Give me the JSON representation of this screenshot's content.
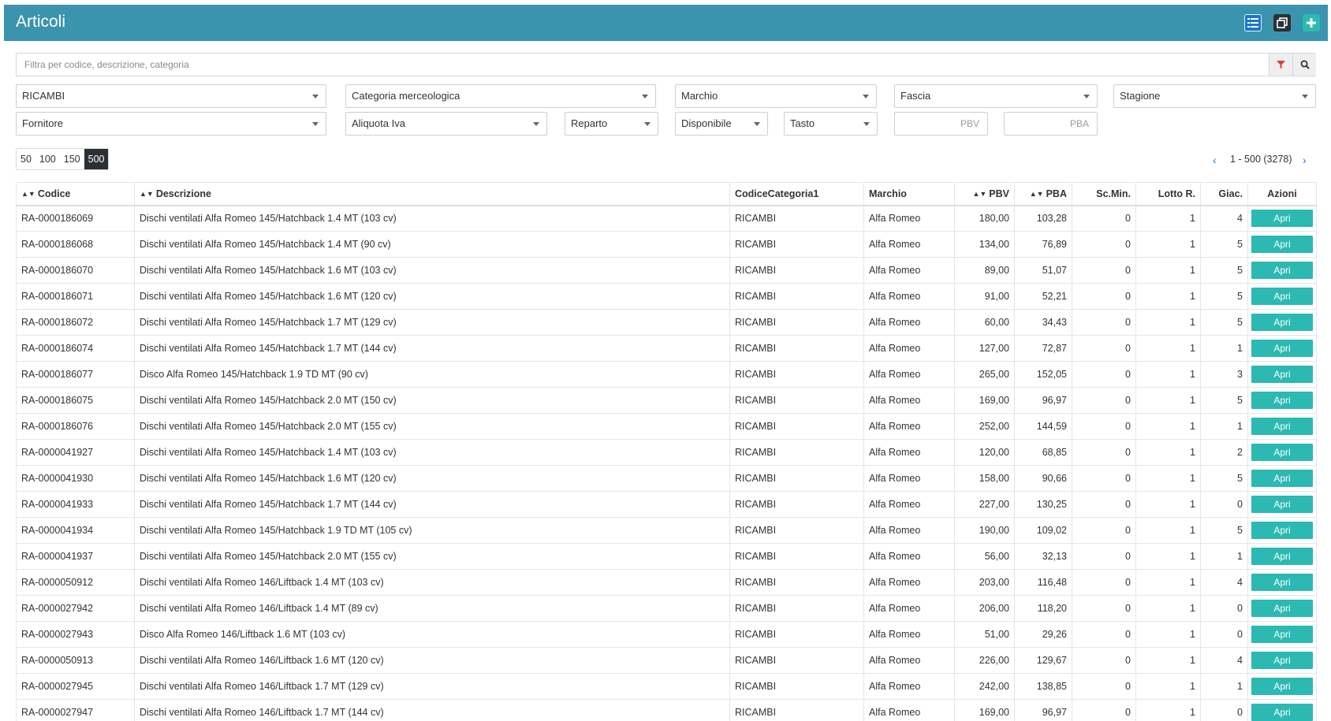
{
  "header": {
    "title": "Articoli"
  },
  "search": {
    "placeholder": "Filtra per codice, descrizione, categoria"
  },
  "filters": {
    "row1": [
      "RICAMBI",
      "Categoria merceologica",
      "Marchio",
      "Fascia",
      "Stagione"
    ],
    "row2": [
      "Fornitore",
      "Aliquota Iva",
      "Reparto",
      "Disponibile",
      "Tasto"
    ],
    "pbv_placeholder": "PBV",
    "pba_placeholder": "PBA"
  },
  "pager": {
    "sizes": [
      "50",
      "100",
      "150",
      "500"
    ],
    "active": "500",
    "range": "1 - 500 (3278)",
    "prev": "‹",
    "next": "›"
  },
  "table": {
    "headers": [
      "Codice",
      "Descrizione",
      "CodiceCategoria1",
      "Marchio",
      "PBV",
      "PBA",
      "Sc.Min.",
      "Lotto R.",
      "Giac.",
      "Azioni"
    ],
    "action_label": "Apri",
    "rows": [
      [
        "RA-0000186069",
        "Dischi ventilati Alfa Romeo 145/Hatchback 1.4 MT (103 cv)",
        "RICAMBI",
        "Alfa Romeo",
        "180,00",
        "103,28",
        "0",
        "1",
        "4"
      ],
      [
        "RA-0000186068",
        "Dischi ventilati Alfa Romeo 145/Hatchback 1.4 MT (90 cv)",
        "RICAMBI",
        "Alfa Romeo",
        "134,00",
        "76,89",
        "0",
        "1",
        "5"
      ],
      [
        "RA-0000186070",
        "Dischi ventilati Alfa Romeo 145/Hatchback 1.6 MT (103 cv)",
        "RICAMBI",
        "Alfa Romeo",
        "89,00",
        "51,07",
        "0",
        "1",
        "5"
      ],
      [
        "RA-0000186071",
        "Dischi ventilati Alfa Romeo 145/Hatchback 1.6 MT (120 cv)",
        "RICAMBI",
        "Alfa Romeo",
        "91,00",
        "52,21",
        "0",
        "1",
        "5"
      ],
      [
        "RA-0000186072",
        "Dischi ventilati Alfa Romeo 145/Hatchback 1.7 MT (129 cv)",
        "RICAMBI",
        "Alfa Romeo",
        "60,00",
        "34,43",
        "0",
        "1",
        "5"
      ],
      [
        "RA-0000186074",
        "Dischi ventilati Alfa Romeo 145/Hatchback 1.7 MT (144 cv)",
        "RICAMBI",
        "Alfa Romeo",
        "127,00",
        "72,87",
        "0",
        "1",
        "1"
      ],
      [
        "RA-0000186077",
        "Disco Alfa Romeo 145/Hatchback 1.9 TD MT (90 cv)",
        "RICAMBI",
        "Alfa Romeo",
        "265,00",
        "152,05",
        "0",
        "1",
        "3"
      ],
      [
        "RA-0000186075",
        "Dischi ventilati Alfa Romeo 145/Hatchback 2.0 MT (150 cv)",
        "RICAMBI",
        "Alfa Romeo",
        "169,00",
        "96,97",
        "0",
        "1",
        "5"
      ],
      [
        "RA-0000186076",
        "Dischi ventilati Alfa Romeo 145/Hatchback 2.0 MT (155 cv)",
        "RICAMBI",
        "Alfa Romeo",
        "252,00",
        "144,59",
        "0",
        "1",
        "1"
      ],
      [
        "RA-0000041927",
        "Dischi ventilati Alfa Romeo 145/Hatchback 1.4 MT (103 cv)",
        "RICAMBI",
        "Alfa Romeo",
        "120,00",
        "68,85",
        "0",
        "1",
        "2"
      ],
      [
        "RA-0000041930",
        "Dischi ventilati Alfa Romeo 145/Hatchback 1.6 MT (120 cv)",
        "RICAMBI",
        "Alfa Romeo",
        "158,00",
        "90,66",
        "0",
        "1",
        "5"
      ],
      [
        "RA-0000041933",
        "Dischi ventilati Alfa Romeo 145/Hatchback 1.7 MT (144 cv)",
        "RICAMBI",
        "Alfa Romeo",
        "227,00",
        "130,25",
        "0",
        "1",
        "0"
      ],
      [
        "RA-0000041934",
        "Dischi ventilati Alfa Romeo 145/Hatchback 1.9 TD MT (105 cv)",
        "RICAMBI",
        "Alfa Romeo",
        "190,00",
        "109,02",
        "0",
        "1",
        "5"
      ],
      [
        "RA-0000041937",
        "Dischi ventilati Alfa Romeo 145/Hatchback 2.0 MT (155 cv)",
        "RICAMBI",
        "Alfa Romeo",
        "56,00",
        "32,13",
        "0",
        "1",
        "1"
      ],
      [
        "RA-0000050912",
        "Dischi ventilati Alfa Romeo 146/Liftback 1.4 MT (103 cv)",
        "RICAMBI",
        "Alfa Romeo",
        "203,00",
        "116,48",
        "0",
        "1",
        "4"
      ],
      [
        "RA-0000027942",
        "Dischi ventilati Alfa Romeo 146/Liftback 1.4 MT (89 cv)",
        "RICAMBI",
        "Alfa Romeo",
        "206,00",
        "118,20",
        "0",
        "1",
        "0"
      ],
      [
        "RA-0000027943",
        "Disco Alfa Romeo 146/Liftback 1.6 MT (103 cv)",
        "RICAMBI",
        "Alfa Romeo",
        "51,00",
        "29,26",
        "0",
        "1",
        "0"
      ],
      [
        "RA-0000050913",
        "Dischi ventilati Alfa Romeo 146/Liftback 1.6 MT (120 cv)",
        "RICAMBI",
        "Alfa Romeo",
        "226,00",
        "129,67",
        "0",
        "1",
        "4"
      ],
      [
        "RA-0000027945",
        "Dischi ventilati Alfa Romeo 146/Liftback 1.7 MT (129 cv)",
        "RICAMBI",
        "Alfa Romeo",
        "242,00",
        "138,85",
        "0",
        "1",
        "1"
      ],
      [
        "RA-0000027947",
        "Dischi ventilati Alfa Romeo 146/Liftback 1.7 MT (144 cv)",
        "RICAMBI",
        "Alfa Romeo",
        "169,00",
        "96,97",
        "0",
        "1",
        "0"
      ]
    ]
  },
  "colors": {
    "header_bg": "#3a94ad",
    "button_teal": "#2bb9b2",
    "active_page": "#2b3036",
    "link_blue": "#1a78c8",
    "filter_red": "#e03b3b"
  }
}
